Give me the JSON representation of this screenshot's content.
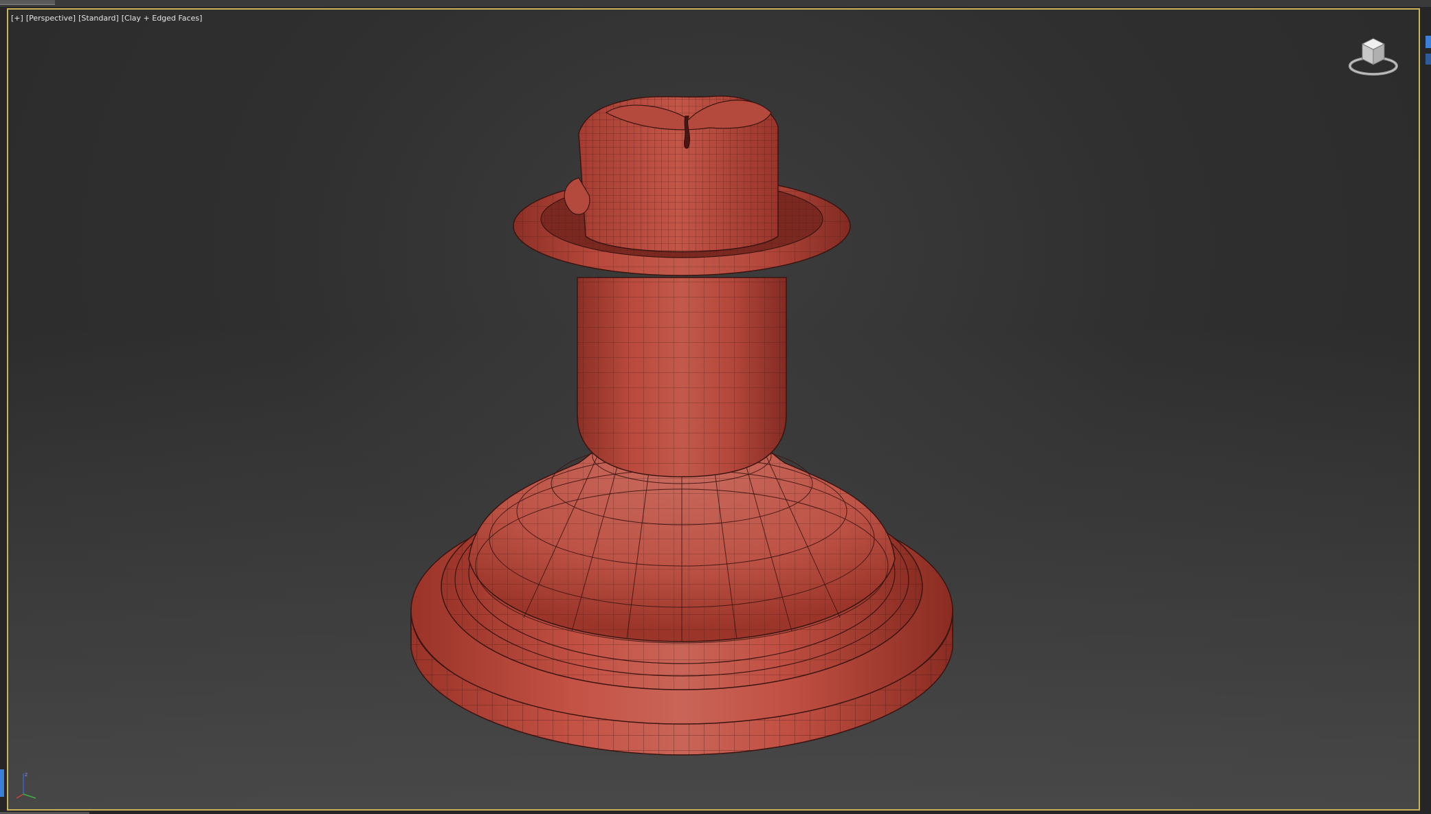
{
  "viewport": {
    "label_parts": [
      "[+]",
      "[Perspective]",
      "[Standard]",
      "[Clay + Edged Faces]"
    ],
    "active_border_color": "#c9b45a",
    "background_color": "#2f2f2f"
  },
  "model": {
    "description_icon": "candle-holder-mesh",
    "mesh_color": "#b84a3e",
    "wire_color": "#3a1410"
  },
  "viewcube": {
    "icon": "viewcube-icon"
  },
  "axis_tripod": {
    "icon": "axis-tripod-icon",
    "x_color": "#d04040",
    "y_color": "#40b040",
    "z_color": "#4060d0"
  }
}
